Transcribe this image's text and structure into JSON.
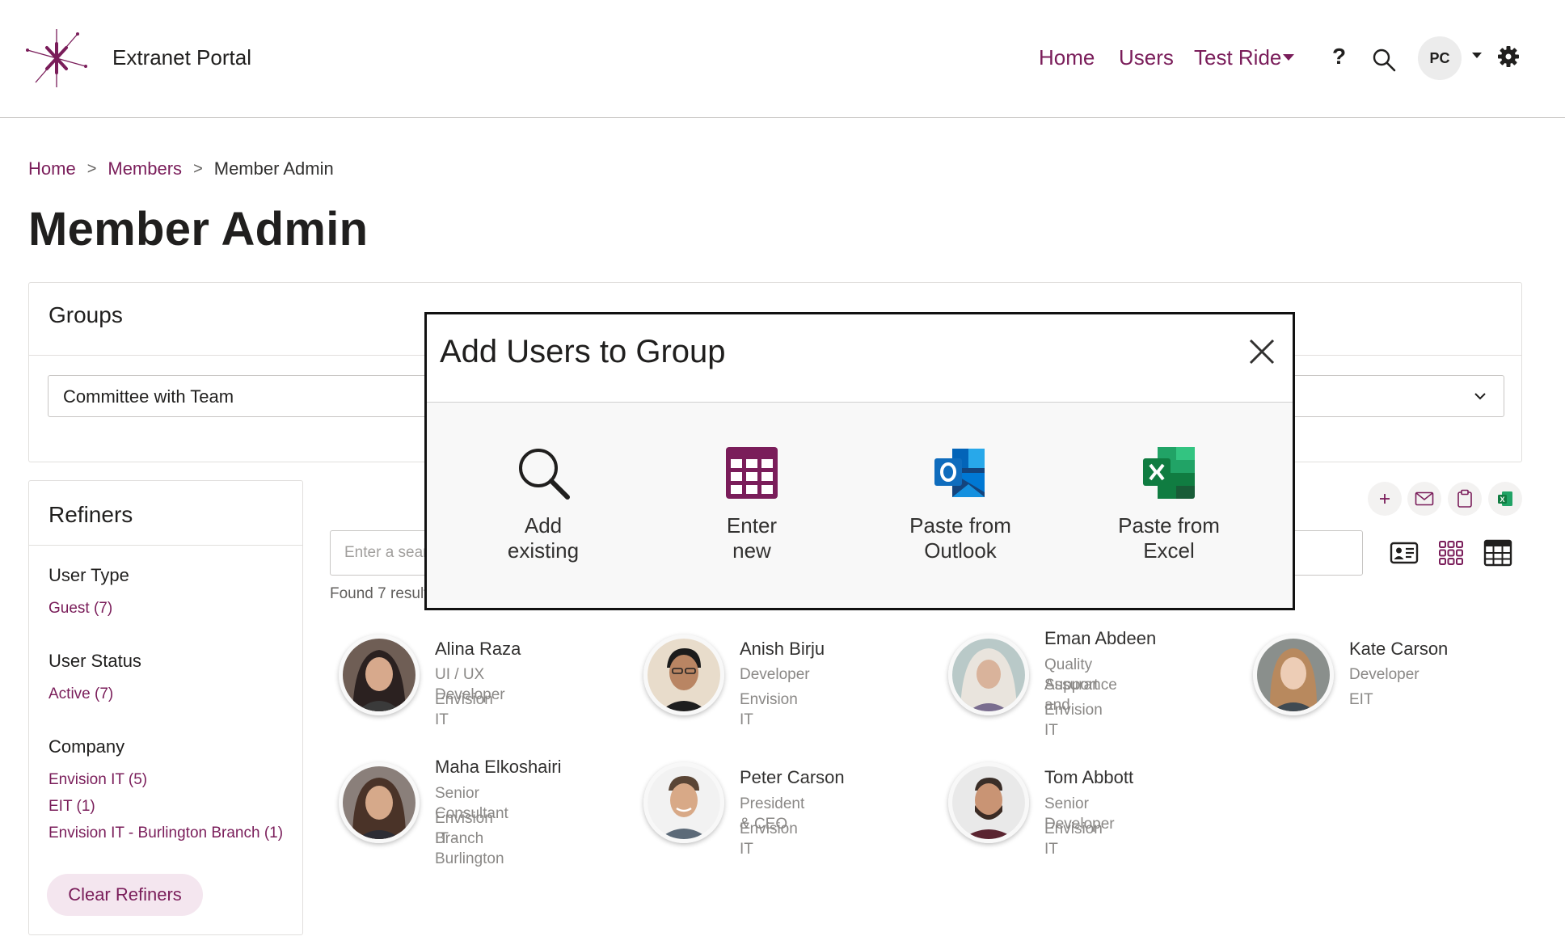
{
  "header": {
    "site_title": "Extranet Portal",
    "nav": [
      {
        "label": "Home"
      },
      {
        "label": "Users"
      },
      {
        "label": "Test Ride"
      }
    ],
    "help_label": "?",
    "avatar_initials": "PC"
  },
  "breadcrumb": {
    "home": "Home",
    "members": "Members",
    "current": "Member Admin",
    "separator": ">"
  },
  "page": {
    "title": "Member Admin"
  },
  "groups": {
    "title": "Groups",
    "selected": "Committee with Team"
  },
  "refiners": {
    "title": "Refiners",
    "sections": [
      {
        "heading": "User Type",
        "items": [
          "Guest (7)"
        ]
      },
      {
        "heading": "User Status",
        "items": [
          "Active (7)"
        ]
      },
      {
        "heading": "Company",
        "items": [
          "Envision IT (5)",
          "EIT (1)",
          "Envision IT - Burlington Branch (1)"
        ]
      }
    ],
    "clear_label": "Clear Refiners"
  },
  "search": {
    "placeholder": "Enter a search term",
    "found_text": "Found 7 results"
  },
  "people": [
    {
      "name": "Alina Raza",
      "lines": [
        "UI / UX Developer",
        "Envision IT"
      ]
    },
    {
      "name": "Anish Birju",
      "lines": [
        "Developer",
        "Envision IT"
      ]
    },
    {
      "name": "Eman Abdeen",
      "lines": [
        "Quality Assurance and",
        "Support",
        "Envision IT"
      ]
    },
    {
      "name": "Kate Carson",
      "lines": [
        "Developer",
        "EIT"
      ]
    },
    {
      "name": "Maha Elkoshairi",
      "lines": [
        "Senior Consultant",
        "Envision IT - Burlington",
        "Branch"
      ]
    },
    {
      "name": "Peter Carson",
      "lines": [
        "President & CEO",
        "Envision IT"
      ]
    },
    {
      "name": "Tom Abbott",
      "lines": [
        "Senior Developer",
        "Envision IT"
      ]
    }
  ],
  "modal": {
    "title": "Add Users to Group",
    "options": [
      {
        "line1": "Add",
        "line2": "existing",
        "icon": "search-icon"
      },
      {
        "line1": "Enter",
        "line2": "new",
        "icon": "table-grid-icon"
      },
      {
        "line1": "Paste from",
        "line2": "Outlook",
        "icon": "outlook-icon"
      },
      {
        "line1": "Paste from",
        "line2": "Excel",
        "icon": "excel-icon"
      }
    ]
  },
  "colors": {
    "accent": "#7a1d5a",
    "outlook_blue": "#0f6cbd",
    "excel_green": "#107c41"
  }
}
